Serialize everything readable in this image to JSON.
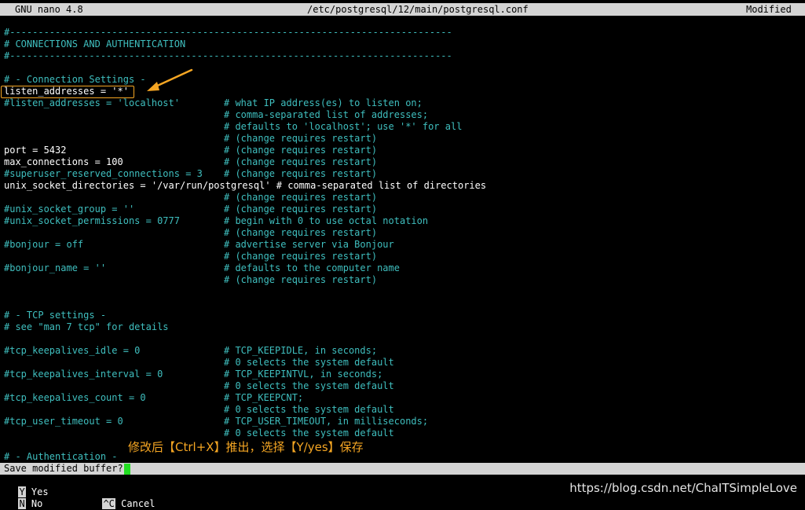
{
  "titlebar": {
    "app": "GNU nano 4.8",
    "path": "/etc/postgresql/12/main/postgresql.conf",
    "status": "Modified"
  },
  "lines": [
    {
      "kind": "cmt",
      "code": "#------------------------------------------------------------------------------",
      "comment": ""
    },
    {
      "kind": "cmt",
      "code": "# CONNECTIONS AND AUTHENTICATION",
      "comment": ""
    },
    {
      "kind": "cmt",
      "code": "#------------------------------------------------------------------------------",
      "comment": ""
    },
    {
      "kind": "blank",
      "code": "",
      "comment": ""
    },
    {
      "kind": "cmt",
      "code": "# - Connection Settings -",
      "comment": ""
    },
    {
      "kind": "txt",
      "code": "listen_addresses = '*'",
      "comment": ""
    },
    {
      "kind": "cmt",
      "code": "#listen_addresses = 'localhost'",
      "comment": "# what IP address(es) to listen on;"
    },
    {
      "kind": "cmt",
      "code": "",
      "comment": "# comma-separated list of addresses;"
    },
    {
      "kind": "cmt",
      "code": "",
      "comment": "# defaults to 'localhost'; use '*' for all"
    },
    {
      "kind": "cmt",
      "code": "",
      "comment": "# (change requires restart)"
    },
    {
      "kind": "txt",
      "code": "port = 5432",
      "comment": "# (change requires restart)"
    },
    {
      "kind": "txt",
      "code": "max_connections = 100",
      "comment": "# (change requires restart)"
    },
    {
      "kind": "cmt",
      "code": "#superuser_reserved_connections = 3",
      "comment": "# (change requires restart)"
    },
    {
      "kind": "txtfull",
      "code": "unix_socket_directories = '/var/run/postgresql' # comma-separated list of directories",
      "comment": ""
    },
    {
      "kind": "cmt",
      "code": "",
      "comment": "# (change requires restart)"
    },
    {
      "kind": "cmt",
      "code": "#unix_socket_group = ''",
      "comment": "# (change requires restart)"
    },
    {
      "kind": "cmt",
      "code": "#unix_socket_permissions = 0777",
      "comment": "# begin with 0 to use octal notation"
    },
    {
      "kind": "cmt",
      "code": "",
      "comment": "# (change requires restart)"
    },
    {
      "kind": "cmt",
      "code": "#bonjour = off",
      "comment": "# advertise server via Bonjour"
    },
    {
      "kind": "cmt",
      "code": "",
      "comment": "# (change requires restart)"
    },
    {
      "kind": "cmt",
      "code": "#bonjour_name = ''",
      "comment": "# defaults to the computer name"
    },
    {
      "kind": "cmt",
      "code": "",
      "comment": "# (change requires restart)"
    },
    {
      "kind": "blank",
      "code": "",
      "comment": ""
    },
    {
      "kind": "blank",
      "code": "",
      "comment": ""
    },
    {
      "kind": "cmt",
      "code": "# - TCP settings -",
      "comment": ""
    },
    {
      "kind": "cmt",
      "code": "# see \"man 7 tcp\" for details",
      "comment": ""
    },
    {
      "kind": "blank",
      "code": "",
      "comment": ""
    },
    {
      "kind": "cmt",
      "code": "#tcp_keepalives_idle = 0",
      "comment": "# TCP_KEEPIDLE, in seconds;"
    },
    {
      "kind": "cmt",
      "code": "",
      "comment": "# 0 selects the system default"
    },
    {
      "kind": "cmt",
      "code": "#tcp_keepalives_interval = 0",
      "comment": "# TCP_KEEPINTVL, in seconds;"
    },
    {
      "kind": "cmt",
      "code": "",
      "comment": "# 0 selects the system default"
    },
    {
      "kind": "cmt",
      "code": "#tcp_keepalives_count = 0",
      "comment": "# TCP_KEEPCNT;"
    },
    {
      "kind": "cmt",
      "code": "",
      "comment": "# 0 selects the system default"
    },
    {
      "kind": "cmt",
      "code": "#tcp_user_timeout = 0",
      "comment": "# TCP_USER_TIMEOUT, in milliseconds;"
    },
    {
      "kind": "cmt",
      "code": "",
      "comment": "# 0 selects the system default"
    },
    {
      "kind": "blank",
      "code": "",
      "comment": ""
    },
    {
      "kind": "cmt",
      "code": "# - Authentication -",
      "comment": ""
    }
  ],
  "annotation": "修改后【Ctrl+X】推出，选择【Y/yes】保存",
  "prompt": "Save modified buffer?",
  "options": [
    {
      "key": "Y",
      "label": "Yes"
    },
    {
      "key": "N",
      "label": "No"
    },
    {
      "key": "^C",
      "label": "Cancel"
    }
  ],
  "watermark": "https://blog.csdn.net/ChaITSimpleLove",
  "colors": {
    "background": "#000000",
    "comment": "#3fbfbf",
    "text": "#ffffff",
    "bar": "#d4d4d4",
    "annotation": "#f5a623",
    "cursor": "#22dd22"
  }
}
